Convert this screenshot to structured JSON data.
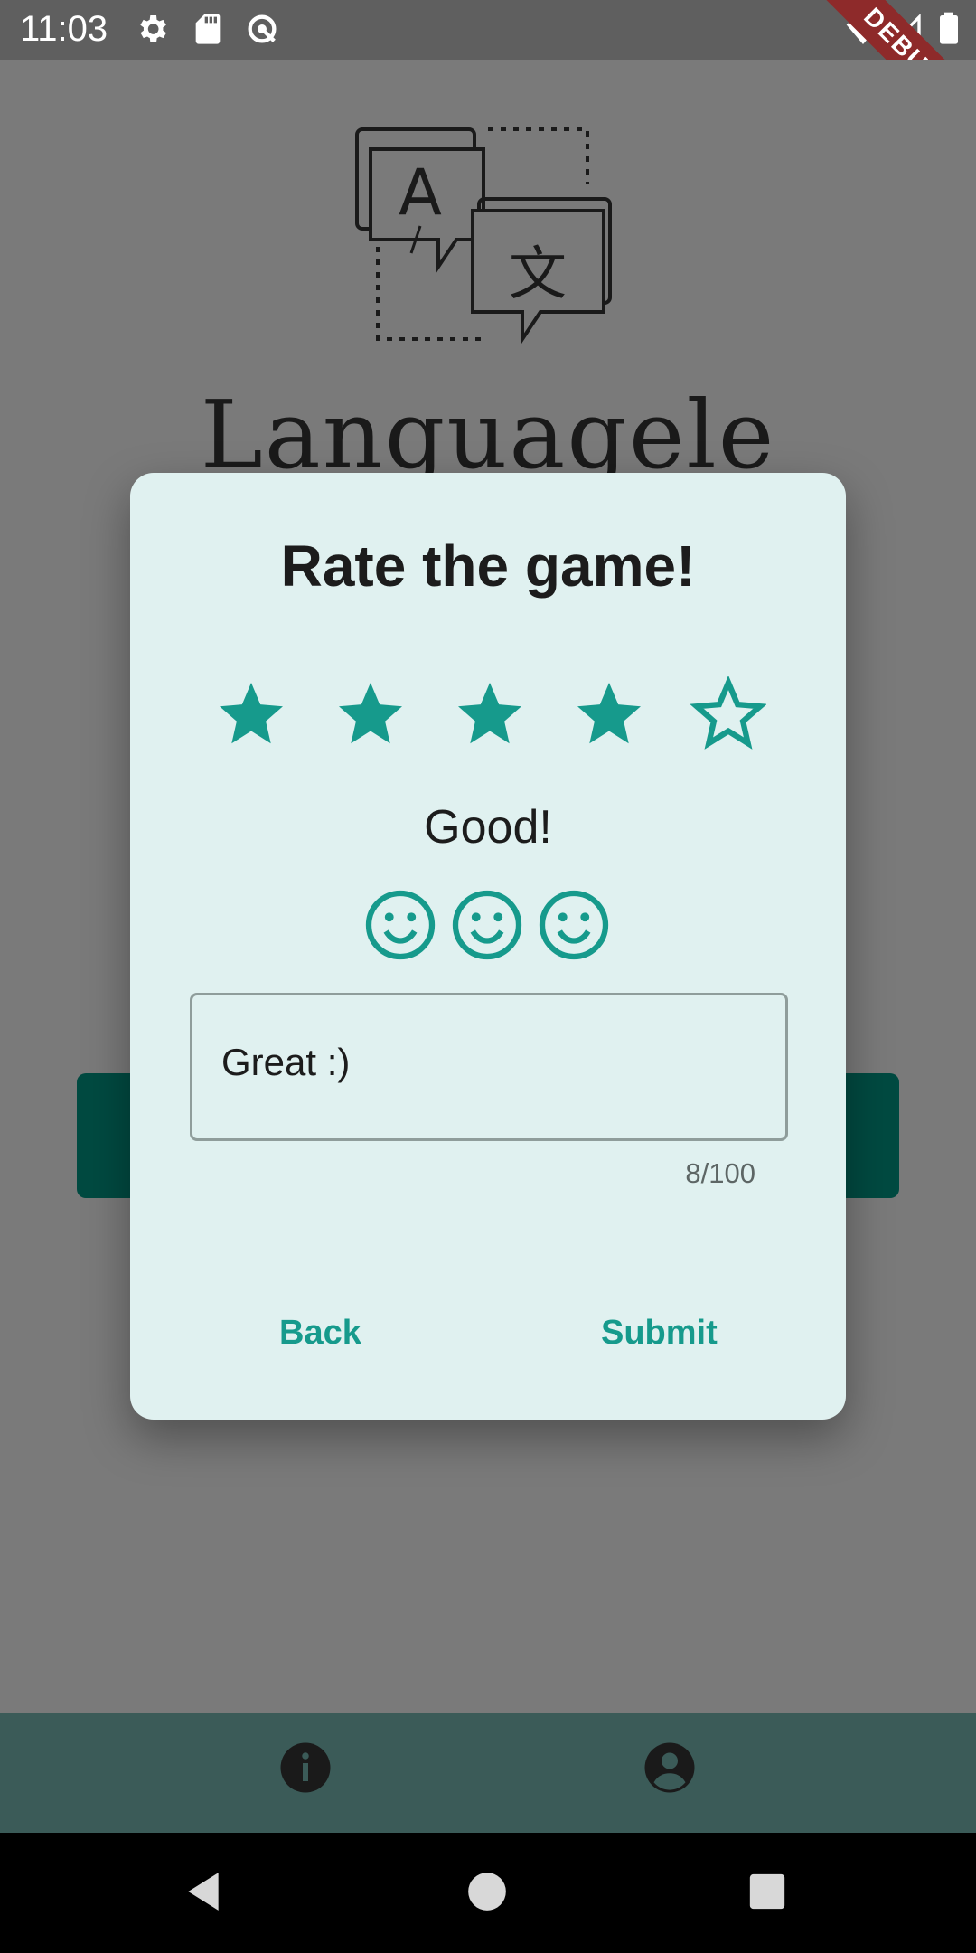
{
  "status_bar": {
    "time": "11:03",
    "debug_label": "DEBUG"
  },
  "app": {
    "name": "Languagele"
  },
  "dialog": {
    "title": "Rate the game!",
    "rating": {
      "value": 4,
      "max": 5
    },
    "rating_label": "Good!",
    "smiley_count": 3,
    "comment": {
      "value": "Great :)",
      "counter": "8/100"
    },
    "back_label": "Back",
    "submit_label": "Submit"
  },
  "bottom_nav": {
    "items": [
      {
        "icon": "info-icon"
      },
      {
        "icon": "account-icon"
      }
    ]
  },
  "colors": {
    "accent": "#169a8c",
    "dialog_bg": "#e0f1f0",
    "nav_bg": "#3b5b58",
    "button_bg": "#004a41"
  }
}
